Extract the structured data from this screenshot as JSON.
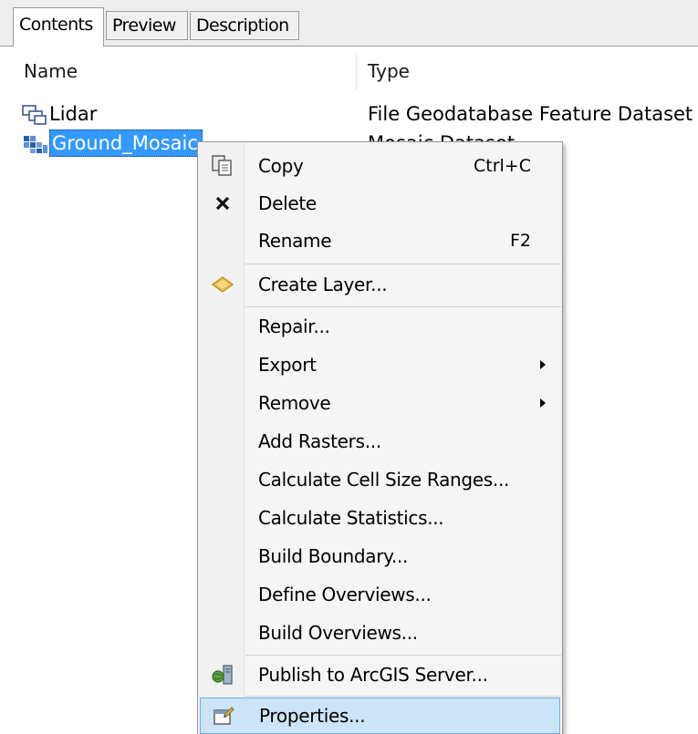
{
  "tabs": [
    {
      "label": "Contents",
      "active": true
    },
    {
      "label": "Preview",
      "active": false
    },
    {
      "label": "Description",
      "active": false
    }
  ],
  "columns": {
    "name": "Name",
    "type": "Type"
  },
  "rows": [
    {
      "name": "Lidar",
      "type": "File Geodatabase Feature Dataset",
      "icon": "feature-dataset-icon",
      "selected": false
    },
    {
      "name": "Ground_Mosaic",
      "type": "Mosaic Dataset",
      "icon": "mosaic-dataset-icon",
      "selected": true
    }
  ],
  "context_menu": {
    "items": [
      {
        "label": "Copy",
        "shortcut": "Ctrl+C",
        "icon": "copy-icon"
      },
      {
        "label": "Delete",
        "icon": "delete-icon"
      },
      {
        "label": "Rename",
        "shortcut": "F2"
      },
      {
        "label": "Create Layer...",
        "icon": "layer-icon"
      },
      {
        "label": "Repair..."
      },
      {
        "label": "Export",
        "submenu": true
      },
      {
        "label": "Remove",
        "submenu": true
      },
      {
        "label": "Add Rasters..."
      },
      {
        "label": "Calculate Cell Size Ranges..."
      },
      {
        "label": "Calculate Statistics..."
      },
      {
        "label": "Build Boundary..."
      },
      {
        "label": "Define Overviews..."
      },
      {
        "label": "Build Overviews..."
      },
      {
        "label": "Publish to ArcGIS Server...",
        "icon": "publish-icon"
      },
      {
        "label": "Properties...",
        "icon": "properties-icon",
        "highlighted": true
      }
    ]
  },
  "colors": {
    "selection": "#3399ff",
    "menu_highlight": "#cce4f7",
    "menu_highlight_border": "#6fb0e6"
  }
}
